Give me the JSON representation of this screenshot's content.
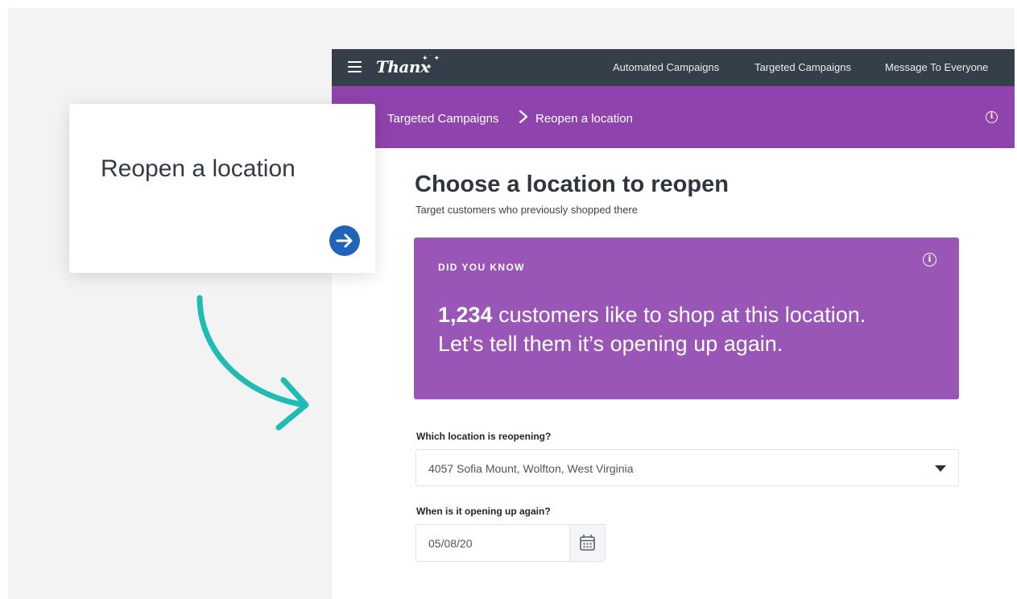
{
  "app": {
    "brand": "Thanx",
    "nav": [
      "Automated Campaigns",
      "Targeted Campaigns",
      "Message To Everyone"
    ]
  },
  "breadcrumb": {
    "parent": "Targeted Campaigns",
    "current": "Reopen a location"
  },
  "page": {
    "title": "Choose a location to reopen",
    "subtitle": "Target customers who previously shopped there"
  },
  "did_you_know": {
    "label": "DID YOU KNOW",
    "count": "1,234",
    "line1_rest": " customers like to shop at this location.",
    "line2": "Let’s tell them it’s opening up again."
  },
  "form": {
    "location_label": "Which location is reopening?",
    "location_value": "4057 Sofia Mount, Wolfton, West Virginia",
    "date_label": "When is it opening up again?",
    "date_value": "05/08/20"
  },
  "tile": {
    "title": "Reopen a location"
  },
  "colors": {
    "topbar": "#343f4a",
    "purple": "#8e43ad",
    "card_purple": "#9a56b6",
    "teal_arrow": "#1fbcb4",
    "go_blue": "#1f64b9"
  }
}
